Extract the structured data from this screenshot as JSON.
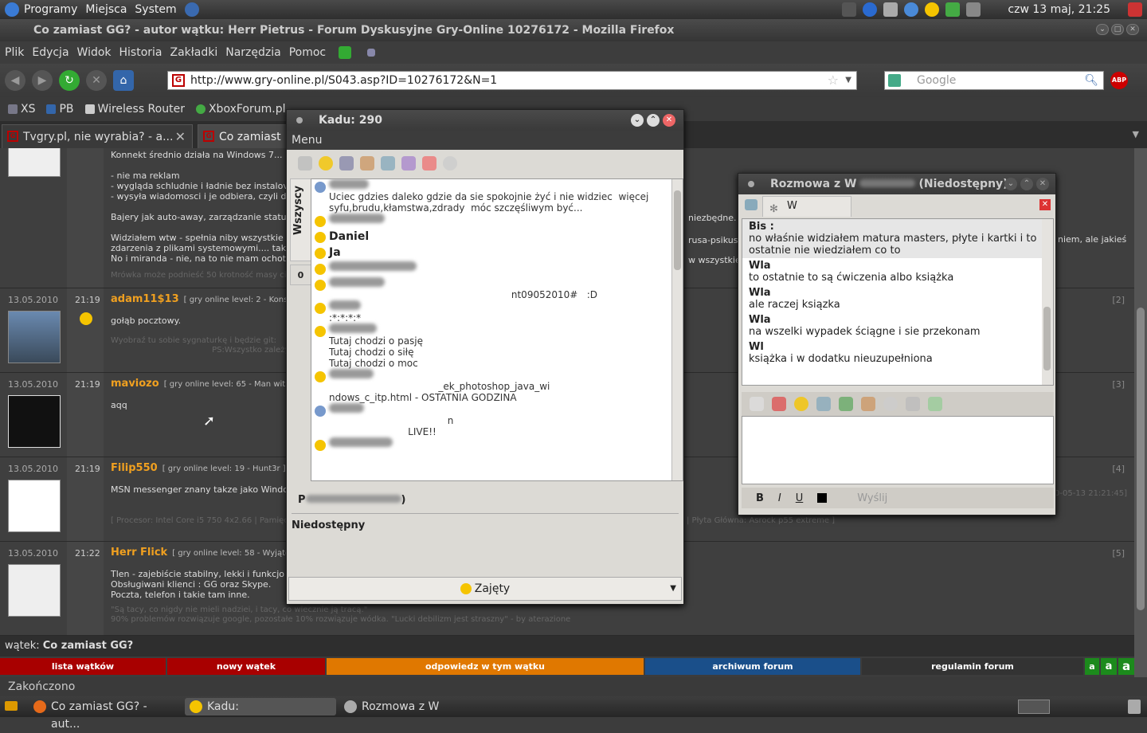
{
  "top_panel": {
    "menus": [
      "Programy",
      "Miejsca",
      "System"
    ],
    "clock": "czw 13 maj, 21:25"
  },
  "firefox": {
    "title": "Co zamiast GG? - autor wątku: Herr Pietrus - Forum Dyskusyjne Gry-Online 10276172 - Mozilla Firefox",
    "menu": [
      "Plik",
      "Edycja",
      "Widok",
      "Historia",
      "Zakładki",
      "Narzędzia",
      "Pomoc"
    ],
    "url": "http://www.gry-online.pl/S043.asp?ID=10276172&N=1",
    "search_placeholder": "Google",
    "abp": "ABP",
    "bookmarks": [
      "XS",
      "PB",
      "Wireless Router",
      "XboxForum.pl"
    ],
    "tabs": [
      "Tvgry.pl, nie wyrabia? - a...",
      "Co zamiast G"
    ],
    "status": "Zakończono"
  },
  "forum": {
    "posts": [
      {
        "date": "",
        "time": "",
        "author": "",
        "meta": "",
        "body": "Konnekt średnio działa na Windows 7...\n\n- nie ma reklam\n- wygląda schludnie i ładnie bez instalov\n- wysyła wiadomosci i je odbiera, czyli d\n\nBajery jak auto-away, zarządzanie status\n\nWidziałem wtw - spełnia niby wszystkie\nzdarzenia z plikami systemowymi.... tak\nNo i miranda - nie, na to nie mam ochoty",
        "sig": "Mrówka może podnieść 50 krotność masy ciał",
        "num": ""
      },
      {
        "date": "13.05.2010",
        "time": "21:19",
        "author": "adam11$13",
        "meta": "[ gry online level: 2 - Konsu",
        "body": "gołąb pocztowy.",
        "sig": "Wyobraź tu sobie sygnaturkę i będzie git:\n                                        PS:Wszystko zależy",
        "num": "[2]"
      },
      {
        "date": "13.05.2010",
        "time": "21:19",
        "author": "maviozo",
        "meta": "[ gry online level: 65 - Man with",
        "body": "aqq",
        "sig": "",
        "num": "[3]"
      },
      {
        "date": "13.05.2010",
        "time": "21:19",
        "author": "Filip550",
        "meta": "[ gry online level: 19 - Hunt3r ]",
        "body": "MSN messenger znany takze jako Windo",
        "sig": "[ Procesor: Intel Core i5 750 4x2.66 | Pamięc:",
        "num": "[4]"
      },
      {
        "date": "13.05.2010",
        "time": "21:22",
        "author": "Herr Flick",
        "meta": "[ gry online level: 58 - Wyjątek",
        "body": "Tlen - zajebiście stabilny, lekki i funkcjo\nObsługiwani klienci : GG oraz Skype.\nPoczta, telefon i takie tam inne.",
        "sig": "\"Są tacy, co nigdy nie mieli nadziei, i tacy, co wiecznie ją tracą.\"\n90% problemów rozwiązuje google, pozostałe 10% rozwiązuje wódka. \"Lucki debilizm jest straszny\" - by aterazione",
        "num": "[5]"
      }
    ],
    "side_snippets": [
      "niezbędne.",
      "rusa-psikusa",
      "niem, ale jakieś",
      "w wszystkie s",
      "0-05-13 21:21:45]",
      "| Płyta Główna: Asrock p55 extreme ]"
    ],
    "thread_label": "wątek:",
    "thread_title": "Co zamiast GG?",
    "buttons": [
      "lista wątków",
      "nowy wątek",
      "odpowiedz w tym wątku",
      "archiwum forum",
      "regulamin forum"
    ],
    "font_sizes": [
      "a",
      "a",
      "a"
    ],
    "colors": {
      "red": "#a80000",
      "orange": "#e07800",
      "blue": "#1a4f8a",
      "dark": "#333333",
      "green": "#1c8a1c",
      "author": "#f0a020"
    }
  },
  "kadu": {
    "title": "Kadu: 290",
    "menu": "Menu",
    "tab_all": "Wszyscy",
    "tab_zero": "0",
    "contacts": [
      {
        "name": "",
        "desc": "Uciec gdzies daleko gdzie da sie spokojnie żyć i nie widziec  więcej\nsyfu,brudu,kłamstwa,zdrady  móc szczęśliwym być..."
      },
      {
        "name": "",
        "desc": ""
      },
      {
        "name": "Daniel",
        "desc": ""
      },
      {
        "name": "Ja",
        "desc": ""
      },
      {
        "name": "",
        "desc": ""
      },
      {
        "name": "",
        "desc": "                                                            nt09052010#   :D"
      },
      {
        "name": "",
        "desc": ":*:*:*:*"
      },
      {
        "name": "",
        "desc": "Tutaj chodzi o pasję\nTutaj chodzi o siłę\nTutaj chodzi o moc"
      },
      {
        "name": "",
        "desc": "                                    _ek_photoshop_java_wi\nndows_c_itp.html - OSTATNIA GODZINA"
      },
      {
        "name": "",
        "desc": "                                       n\n                          LIVE!!"
      },
      {
        "name": "",
        "desc": ""
      }
    ],
    "profile": "P",
    "profile_end": ")",
    "status_desc": "Niedostępny",
    "status": "Zajęty"
  },
  "chat": {
    "title": "Rozmowa z W",
    "title_status": "(Niedostępny)",
    "tab": "W",
    "messages": [
      {
        "who": "Bis :",
        "text": "no właśnie widziałem matura masters, płyte i kartki i to ostatnie nie wiedziałem co to",
        "hl": true
      },
      {
        "who": "Wla",
        "text": "to ostatnie to są ćwiczenia albo książka",
        "hl": false
      },
      {
        "who": "Wla",
        "text": "ale raczej ksiązka",
        "hl": false
      },
      {
        "who": "Wla",
        "text": "na wszelki wypadek ściągne i sie przekonam",
        "hl": false
      },
      {
        "who": "Wl",
        "text": "książka i w dodatku nieuzupełniona",
        "hl": false
      }
    ],
    "format": [
      "B",
      "I",
      "U"
    ],
    "send": "Wyślij"
  },
  "taskbar": {
    "items": [
      "Co zamiast GG? - aut...",
      "Kadu: ",
      "Rozmowa z W"
    ]
  }
}
